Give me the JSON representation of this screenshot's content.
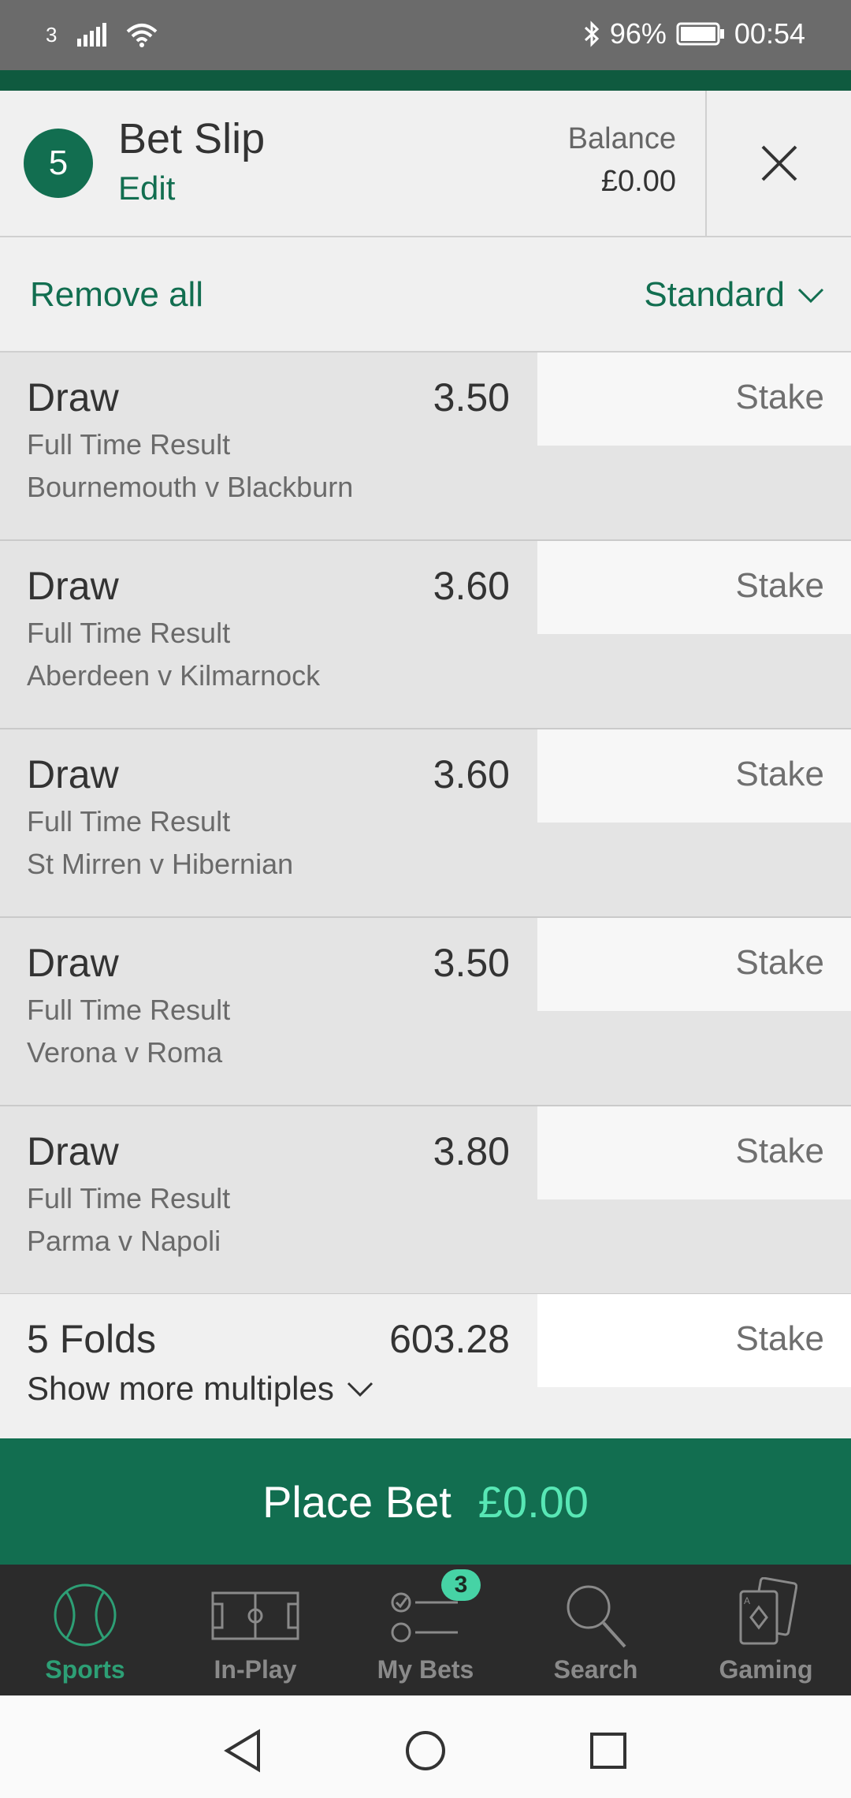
{
  "status_bar": {
    "carrier": "3",
    "battery": "96%",
    "time": "00:54"
  },
  "header": {
    "count": "5",
    "title": "Bet Slip",
    "edit_label": "Edit",
    "balance_label": "Balance",
    "balance_value": "£0.00"
  },
  "toolbar": {
    "remove_all": "Remove all",
    "bet_type": "Standard"
  },
  "selections": [
    {
      "name": "Draw",
      "odds": "3.50",
      "market": "Full Time Result",
      "event": "Bournemouth v Blackburn",
      "stake_placeholder": "Stake"
    },
    {
      "name": "Draw",
      "odds": "3.60",
      "market": "Full Time Result",
      "event": "Aberdeen v Kilmarnock",
      "stake_placeholder": "Stake"
    },
    {
      "name": "Draw",
      "odds": "3.60",
      "market": "Full Time Result",
      "event": "St Mirren v Hibernian",
      "stake_placeholder": "Stake"
    },
    {
      "name": "Draw",
      "odds": "3.50",
      "market": "Full Time Result",
      "event": "Verona v Roma",
      "stake_placeholder": "Stake"
    },
    {
      "name": "Draw",
      "odds": "3.80",
      "market": "Full Time Result",
      "event": "Parma v Napoli",
      "stake_placeholder": "Stake"
    }
  ],
  "multiples": {
    "name": "5 Folds",
    "odds": "603.28",
    "stake_placeholder": "Stake",
    "show_more": "Show more multiples"
  },
  "place_bet": {
    "label": "Place Bet",
    "amount": "£0.00"
  },
  "bottom_nav": [
    {
      "label": "Sports",
      "icon": "tennis-ball-icon",
      "active": true
    },
    {
      "label": "In-Play",
      "icon": "pitch-icon",
      "active": false
    },
    {
      "label": "My Bets",
      "icon": "bets-list-icon",
      "badge": "3",
      "active": false
    },
    {
      "label": "Search",
      "icon": "search-icon",
      "active": false
    },
    {
      "label": "Gaming",
      "icon": "cards-icon",
      "active": false
    }
  ],
  "colors": {
    "brand_green": "#126e50",
    "accent_mint": "#58e7b5",
    "nav_bg": "#2b2b2b"
  }
}
